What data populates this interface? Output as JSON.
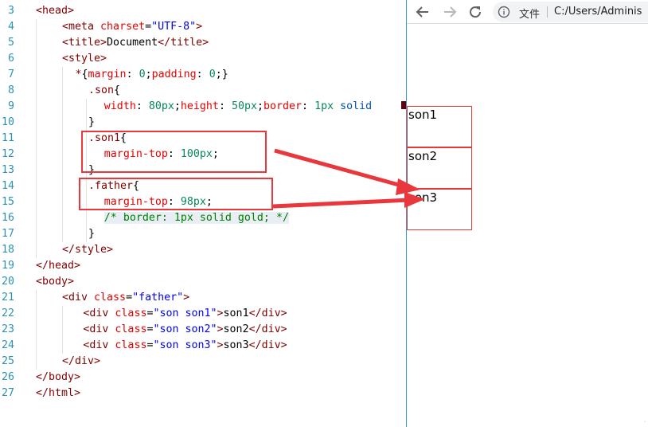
{
  "editor": {
    "lines": [
      {
        "n": "3",
        "indent": 0,
        "parts": [
          [
            "tag",
            "<head>"
          ]
        ]
      },
      {
        "n": "4",
        "indent": 1,
        "parts": [
          [
            "tag",
            "<meta "
          ],
          [
            "attr",
            "charset"
          ],
          [
            "plain",
            "="
          ],
          [
            "str",
            "\"UTF-8\""
          ],
          [
            "tag",
            ">"
          ]
        ]
      },
      {
        "n": "5",
        "indent": 1,
        "parts": [
          [
            "tag",
            "<title>"
          ],
          [
            "plain",
            "Document"
          ],
          [
            "tag",
            "</title>"
          ]
        ]
      },
      {
        "n": "6",
        "indent": 1,
        "parts": [
          [
            "tag",
            "<style>"
          ]
        ]
      },
      {
        "n": "7",
        "indent": 1.5,
        "parts": [
          [
            "sel",
            "*"
          ],
          [
            "plain",
            "{"
          ],
          [
            "prop",
            "margin"
          ],
          [
            "plain",
            ": "
          ],
          [
            "num",
            "0"
          ],
          [
            "plain",
            ";"
          ],
          [
            "prop",
            "padding"
          ],
          [
            "plain",
            ": "
          ],
          [
            "num",
            "0"
          ],
          [
            "plain",
            ";}"
          ]
        ]
      },
      {
        "n": "8",
        "indent": 2,
        "parts": [
          [
            "sel",
            ".son"
          ],
          [
            "plain",
            "{"
          ]
        ]
      },
      {
        "n": "9",
        "indent": 2.6,
        "parts": [
          [
            "prop",
            "width"
          ],
          [
            "plain",
            ": "
          ],
          [
            "num",
            "80px"
          ],
          [
            "plain",
            ";"
          ],
          [
            "prop",
            "height"
          ],
          [
            "plain",
            ": "
          ],
          [
            "num",
            "50px"
          ],
          [
            "plain",
            ";"
          ],
          [
            "prop",
            "border"
          ],
          [
            "plain",
            ": "
          ],
          [
            "num",
            "1px"
          ],
          [
            "plain",
            " "
          ],
          [
            "val",
            "solid"
          ]
        ]
      },
      {
        "n": "10",
        "indent": 2,
        "parts": [
          [
            "plain",
            "}"
          ]
        ]
      },
      {
        "n": "11",
        "indent": 2,
        "parts": [
          [
            "sel",
            ".son1"
          ],
          [
            "plain",
            "{"
          ]
        ]
      },
      {
        "n": "12",
        "indent": 2.6,
        "parts": [
          [
            "prop",
            "margin-top"
          ],
          [
            "plain",
            ": "
          ],
          [
            "num",
            "100px"
          ],
          [
            "plain",
            ";"
          ]
        ]
      },
      {
        "n": "13",
        "indent": 2,
        "parts": [
          [
            "plain",
            "}"
          ]
        ]
      },
      {
        "n": "14",
        "indent": 2,
        "parts": [
          [
            "sel",
            ".father"
          ],
          [
            "plain",
            "{"
          ]
        ]
      },
      {
        "n": "15",
        "indent": 2.6,
        "parts": [
          [
            "prop",
            "margin-top"
          ],
          [
            "plain",
            ": "
          ],
          [
            "num",
            "98px"
          ],
          [
            "plain",
            ";"
          ]
        ]
      },
      {
        "n": "16",
        "indent": 2.6,
        "parts": [
          [
            "cmt",
            "/* border: 1px solid gold; */"
          ]
        ]
      },
      {
        "n": "17",
        "indent": 2,
        "parts": [
          [
            "plain",
            "}"
          ]
        ]
      },
      {
        "n": "18",
        "indent": 1,
        "parts": [
          [
            "tag",
            "</style>"
          ]
        ]
      },
      {
        "n": "19",
        "indent": 0,
        "parts": [
          [
            "tag",
            "</head>"
          ]
        ]
      },
      {
        "n": "20",
        "indent": 0,
        "parts": [
          [
            "tag",
            "<body>"
          ]
        ]
      },
      {
        "n": "21",
        "indent": 1,
        "parts": [
          [
            "tag",
            "<div "
          ],
          [
            "attr",
            "class"
          ],
          [
            "plain",
            "="
          ],
          [
            "str",
            "\"father\""
          ],
          [
            "tag",
            ">"
          ]
        ]
      },
      {
        "n": "22",
        "indent": 1.8,
        "parts": [
          [
            "tag",
            "<div "
          ],
          [
            "attr",
            "class"
          ],
          [
            "plain",
            "="
          ],
          [
            "str",
            "\"son son1\""
          ],
          [
            "tag",
            ">"
          ],
          [
            "plain",
            "son1"
          ],
          [
            "tag",
            "</div>"
          ]
        ]
      },
      {
        "n": "23",
        "indent": 1.8,
        "parts": [
          [
            "tag",
            "<div "
          ],
          [
            "attr",
            "class"
          ],
          [
            "plain",
            "="
          ],
          [
            "str",
            "\"son son2\""
          ],
          [
            "tag",
            ">"
          ],
          [
            "plain",
            "son2"
          ],
          [
            "tag",
            "</div>"
          ]
        ]
      },
      {
        "n": "24",
        "indent": 1.8,
        "parts": [
          [
            "tag",
            "<div "
          ],
          [
            "attr",
            "class"
          ],
          [
            "plain",
            "="
          ],
          [
            "str",
            "\"son son3\""
          ],
          [
            "tag",
            ">"
          ],
          [
            "plain",
            "son3"
          ],
          [
            "tag",
            "</div>"
          ]
        ]
      },
      {
        "n": "25",
        "indent": 1,
        "parts": [
          [
            "tag",
            "</div>"
          ]
        ]
      },
      {
        "n": "26",
        "indent": 0,
        "parts": [
          [
            "tag",
            "</body>"
          ]
        ]
      },
      {
        "n": "27",
        "indent": 0,
        "parts": [
          [
            "tag",
            "</html>"
          ]
        ]
      }
    ]
  },
  "browser": {
    "back_icon": "arrow-back-icon",
    "forward_icon": "arrow-forward-icon",
    "reload_icon": "reload-icon",
    "info_icon": "info-icon",
    "address_label": "文件",
    "address_url": "C:/Users/Adminis",
    "boxes": [
      "son1",
      "son2",
      "son3"
    ]
  },
  "colors": {
    "annotation": "#e8383d",
    "box_border": "#e53935",
    "browser_divider": "#3b9bc8"
  }
}
